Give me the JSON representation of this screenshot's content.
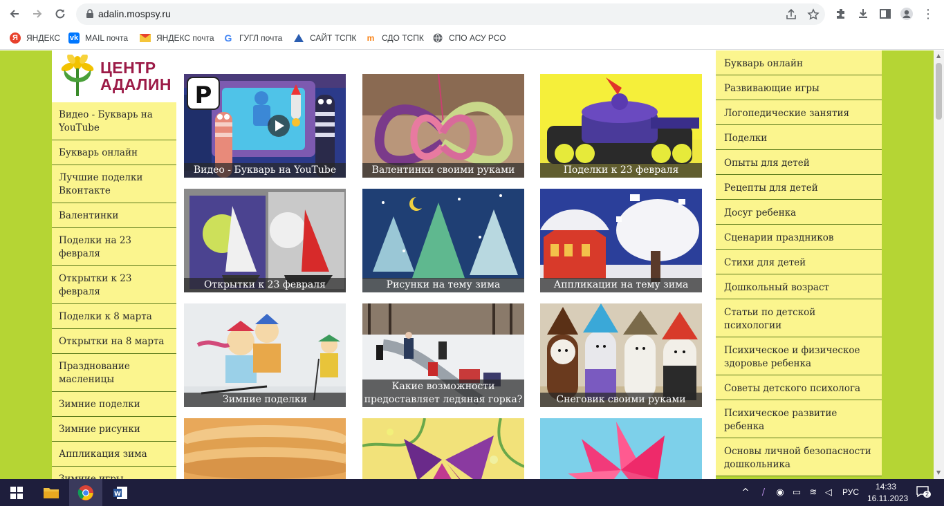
{
  "browser": {
    "url": "adalin.mospsy.ru",
    "bookmarks": [
      {
        "label": "ЯНДЕКС",
        "icon": "yandex-icon",
        "color": "#e8412c"
      },
      {
        "label": "MAIL почта",
        "icon": "vk-icon",
        "color": "#0077ff"
      },
      {
        "label": "ЯНДЕКС почта",
        "icon": "yandex-mail-icon",
        "color": "#e8412c"
      },
      {
        "label": "ГУГЛ почта",
        "icon": "google-icon",
        "color": "#4285f4"
      },
      {
        "label": "САЙТ ТСПК",
        "icon": "tspk-icon",
        "color": "#2a5db0"
      },
      {
        "label": "СДО ТСПК",
        "icon": "moodle-icon",
        "color": "#f98012"
      },
      {
        "label": "СПО АСУ РСО",
        "icon": "globe-icon",
        "color": "#5f6368"
      }
    ]
  },
  "site": {
    "logo_line1": "ЦЕНТР",
    "logo_line2": "АДАЛИН",
    "brand_color": "#9c1b47",
    "background_color": "#b5d534",
    "menu_color": "#fbf58e"
  },
  "left_menu": [
    {
      "label": "Видео - Букварь на YouTube",
      "lines": 2
    },
    {
      "label": "Букварь онлайн",
      "lines": 1
    },
    {
      "label": "Лучшие поделки Вконтакте",
      "lines": 2
    },
    {
      "label": "Валентинки",
      "lines": 1
    },
    {
      "label": "Поделки на 23 февраля",
      "lines": 2
    },
    {
      "label": "Открытки к 23 февраля",
      "lines": 2
    },
    {
      "label": "Поделки к 8 марта",
      "lines": 1
    },
    {
      "label": "Открытки на 8 марта",
      "lines": 1
    },
    {
      "label": "Празднование масленицы",
      "lines": 2
    },
    {
      "label": "Зимние поделки",
      "lines": 1
    },
    {
      "label": "Зимние рисунки",
      "lines": 1
    },
    {
      "label": "Аппликация зима",
      "lines": 1
    },
    {
      "label": "Зимние игры",
      "lines": 1
    }
  ],
  "tiles": [
    {
      "caption": "Видео - Букварь на YouTube"
    },
    {
      "caption": "Валентинки своими руками"
    },
    {
      "caption": "Поделки к 23 февраля"
    },
    {
      "caption": "Открытки к 23 февраля"
    },
    {
      "caption": "Рисунки на тему зима"
    },
    {
      "caption": "Аппликации на тему зима"
    },
    {
      "caption": "Зимние поделки"
    },
    {
      "caption": "Какие возможности предоставляет ледяная горка?"
    },
    {
      "caption": "Снеговик своими руками"
    },
    {
      "caption": ""
    },
    {
      "caption": ""
    },
    {
      "caption": ""
    }
  ],
  "right_menu": [
    {
      "label": "Букварь онлайн",
      "lines": 1
    },
    {
      "label": "Развивающие игры",
      "lines": 1
    },
    {
      "label": "Логопедические занятия",
      "lines": 1
    },
    {
      "label": "Поделки",
      "lines": 1
    },
    {
      "label": "Опыты для детей",
      "lines": 1
    },
    {
      "label": "Рецепты для детей",
      "lines": 1
    },
    {
      "label": "Досуг ребенка",
      "lines": 1
    },
    {
      "label": "Сценарии праздников",
      "lines": 1
    },
    {
      "label": "Стихи для детей",
      "lines": 1
    },
    {
      "label": "Дошкольный возраст",
      "lines": 1
    },
    {
      "label": "Статьи по детской психологии",
      "lines": 2
    },
    {
      "label": "Психическое и физическое здоровье ребенка",
      "lines": 2
    },
    {
      "label": "Советы детского психолога",
      "lines": 1
    },
    {
      "label": "Психическое развитие ребенка",
      "lines": 2
    },
    {
      "label": "Основы личной безопасности дошкольника",
      "lines": 2
    }
  ],
  "taskbar": {
    "language": "РУС",
    "time": "14:33",
    "date": "16.11.2023",
    "notifications": "2"
  }
}
